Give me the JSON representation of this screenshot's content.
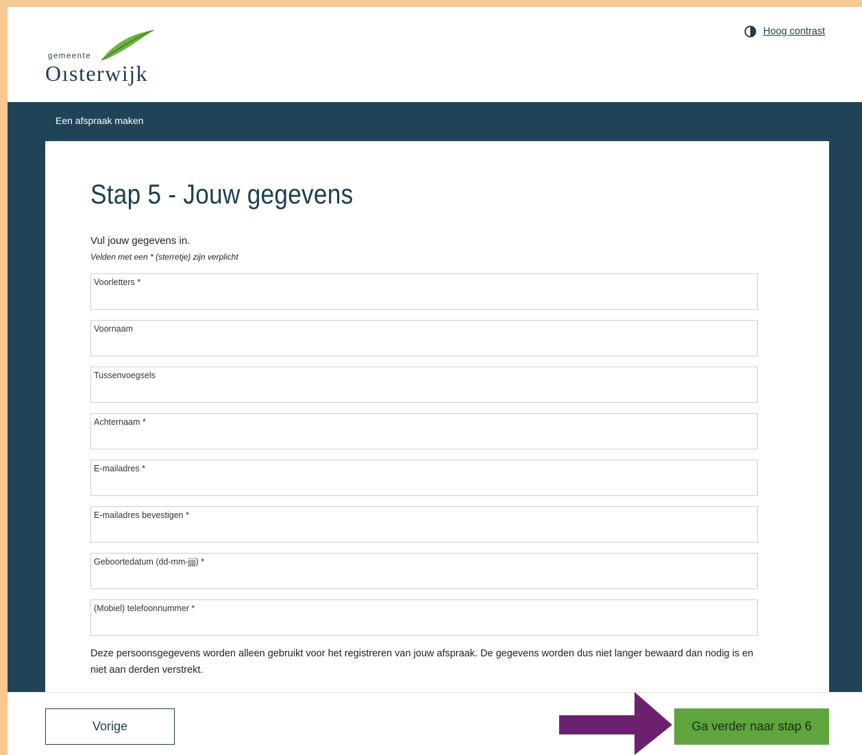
{
  "header": {
    "logo_small": "gemeente",
    "logo_big": "Oısterwijk",
    "contrast_label": "Hoog contrast"
  },
  "band": {
    "title": "Een afspraak maken"
  },
  "main": {
    "title": "Stap 5 - Jouw gegevens",
    "intro": "Vul jouw gegevens in.",
    "required_note": "Velden met een * (sterretje) zijn verplicht",
    "fields": [
      {
        "label": "Voorletters *",
        "value": ""
      },
      {
        "label": "Voornaam",
        "value": ""
      },
      {
        "label": "Tussenvoegsels",
        "value": ""
      },
      {
        "label": "Achternaam *",
        "value": ""
      },
      {
        "label": "E-mailadres *",
        "value": ""
      },
      {
        "label": "E-mailadres bevestigen *",
        "value": ""
      },
      {
        "label": "Geboortedatum (dd-mm-jjjj) *",
        "value": ""
      },
      {
        "label": "(Mobiel) telefoonnummer *",
        "value": ""
      }
    ],
    "privacy_text": "Deze persoonsgegevens worden alleen gebruikt voor het registreren van jouw afspraak. De gegevens worden dus niet langer bewaard dan nodig is en niet aan derden verstrekt."
  },
  "footer": {
    "prev_label": "Vorige",
    "next_label": "Ga verder naar stap 6"
  },
  "colors": {
    "brand_dark": "#214357",
    "accent_green": "#5ea53d",
    "arrow_purple": "#6b2170",
    "frame_border": "#f6c993"
  },
  "icons": {
    "contrast": "contrast-icon",
    "leaf": "leaf-logo",
    "annotation_arrow": "arrow-right-icon"
  }
}
